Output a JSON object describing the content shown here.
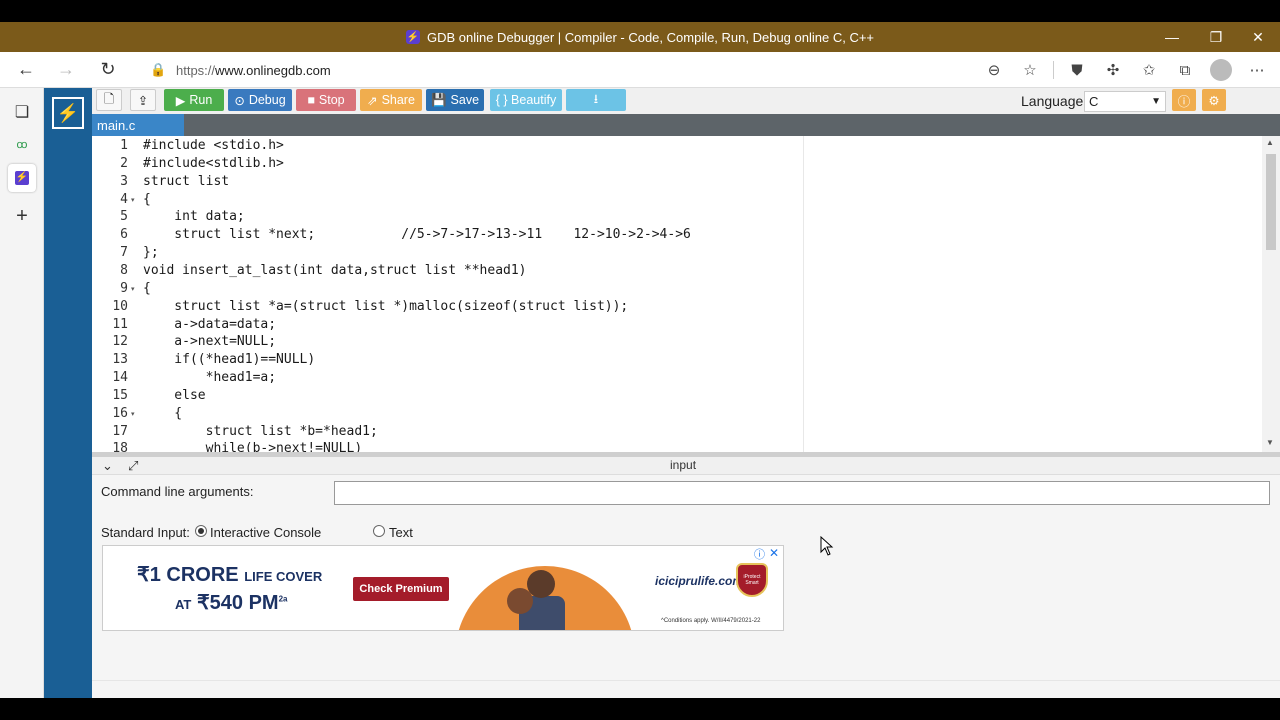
{
  "browser": {
    "title": "GDB online Debugger | Compiler - Code, Compile, Run, Debug online C, C++",
    "url_scheme": "https://",
    "url_host": "www.onlinegdb.com"
  },
  "toolbar": {
    "run_label": "Run",
    "debug_label": "Debug",
    "stop_label": "Stop",
    "share_label": "Share",
    "save_label": "Save",
    "beautify_label": "{ } Beautify",
    "language_label": "Language",
    "language_value": "C",
    "colors": {
      "run": "#4cae4c",
      "debug": "#3a7abf",
      "stop": "#d9737a",
      "share": "#f0ad4e",
      "save": "#2a6fb0",
      "beautify": "#6cc3e6",
      "download": "#6cc3e6",
      "info": "#f0ad4e"
    }
  },
  "tab": {
    "filename": "main.c"
  },
  "editor": {
    "lines": [
      {
        "n": "1",
        "fold": "",
        "text": "#include <stdio.h>"
      },
      {
        "n": "2",
        "fold": "",
        "text": "#include<stdlib.h>"
      },
      {
        "n": "3",
        "fold": "",
        "text": "struct list"
      },
      {
        "n": "4",
        "fold": "▾",
        "text": "{"
      },
      {
        "n": "5",
        "fold": "",
        "text": "    int data;"
      },
      {
        "n": "6",
        "fold": "",
        "text": "    struct list *next;           //5->7->17->13->11    12->10->2->4->6"
      },
      {
        "n": "7",
        "fold": "",
        "text": "};"
      },
      {
        "n": "8",
        "fold": "",
        "text": "void insert_at_last(int data,struct list **head1)"
      },
      {
        "n": "9",
        "fold": "▾",
        "text": "{"
      },
      {
        "n": "10",
        "fold": "",
        "text": "    struct list *a=(struct list *)malloc(sizeof(struct list));"
      },
      {
        "n": "11",
        "fold": "",
        "text": "    a->data=data;"
      },
      {
        "n": "12",
        "fold": "",
        "text": "    a->next=NULL;"
      },
      {
        "n": "13",
        "fold": "",
        "text": "    if((*head1)==NULL)"
      },
      {
        "n": "14",
        "fold": "",
        "text": "        *head1=a;"
      },
      {
        "n": "15",
        "fold": "",
        "text": "    else"
      },
      {
        "n": "16",
        "fold": "▾",
        "text": "    {"
      },
      {
        "n": "17",
        "fold": "",
        "text": "        struct list *b=*head1;"
      },
      {
        "n": "18",
        "fold": "",
        "text": "        while(b->next!=NULL)"
      }
    ]
  },
  "input_panel": {
    "title": "input",
    "cmd_args_label": "Command line arguments:",
    "cmd_args_value": "",
    "stdin_label": "Standard Input:",
    "option_interactive": "Interactive Console",
    "option_text": "Text",
    "selected": "interactive"
  },
  "ad": {
    "line1_main": "₹1 CRORE",
    "line1_small": "LIFE COVER",
    "line2_small": "AT",
    "line2_main": "₹540 PM",
    "line2_sup": "2a",
    "cta": "Check Premium",
    "brand": "iciciprulife.com",
    "badge": "iProtect Smart",
    "fine_print": "^Conditions apply.  W/II/4479/2021-22"
  }
}
